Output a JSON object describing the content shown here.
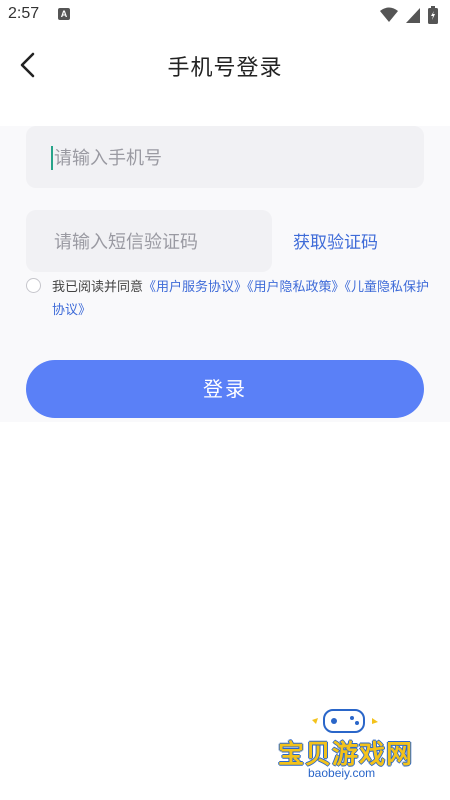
{
  "status_bar": {
    "time": "2:57",
    "notification_icon": "a-icon",
    "icons": [
      "wifi-icon",
      "signal-icon",
      "battery-icon"
    ]
  },
  "header": {
    "title": "手机号登录",
    "back_icon": "chevron-left-icon"
  },
  "form": {
    "phone_placeholder": "请输入手机号",
    "phone_value": "",
    "code_placeholder": "请输入短信验证码",
    "code_value": "",
    "get_code_label": "获取验证码",
    "agreement": {
      "prefix": "我已阅读并同意",
      "links": [
        "《用户服务协议》",
        "《用户隐私政策》",
        "《儿童隐私保护协议》"
      ],
      "checked": false
    },
    "login_label": "登录"
  },
  "watermark": {
    "text": "宝贝游戏网",
    "url": "baobeiy.com"
  },
  "colors": {
    "accent": "#5a80f7",
    "link": "#3e6bd8",
    "field_bg": "#f1f1f4",
    "cursor": "#27a389",
    "watermark_yellow": "#f3c21b",
    "watermark_blue": "#2a66c9"
  }
}
